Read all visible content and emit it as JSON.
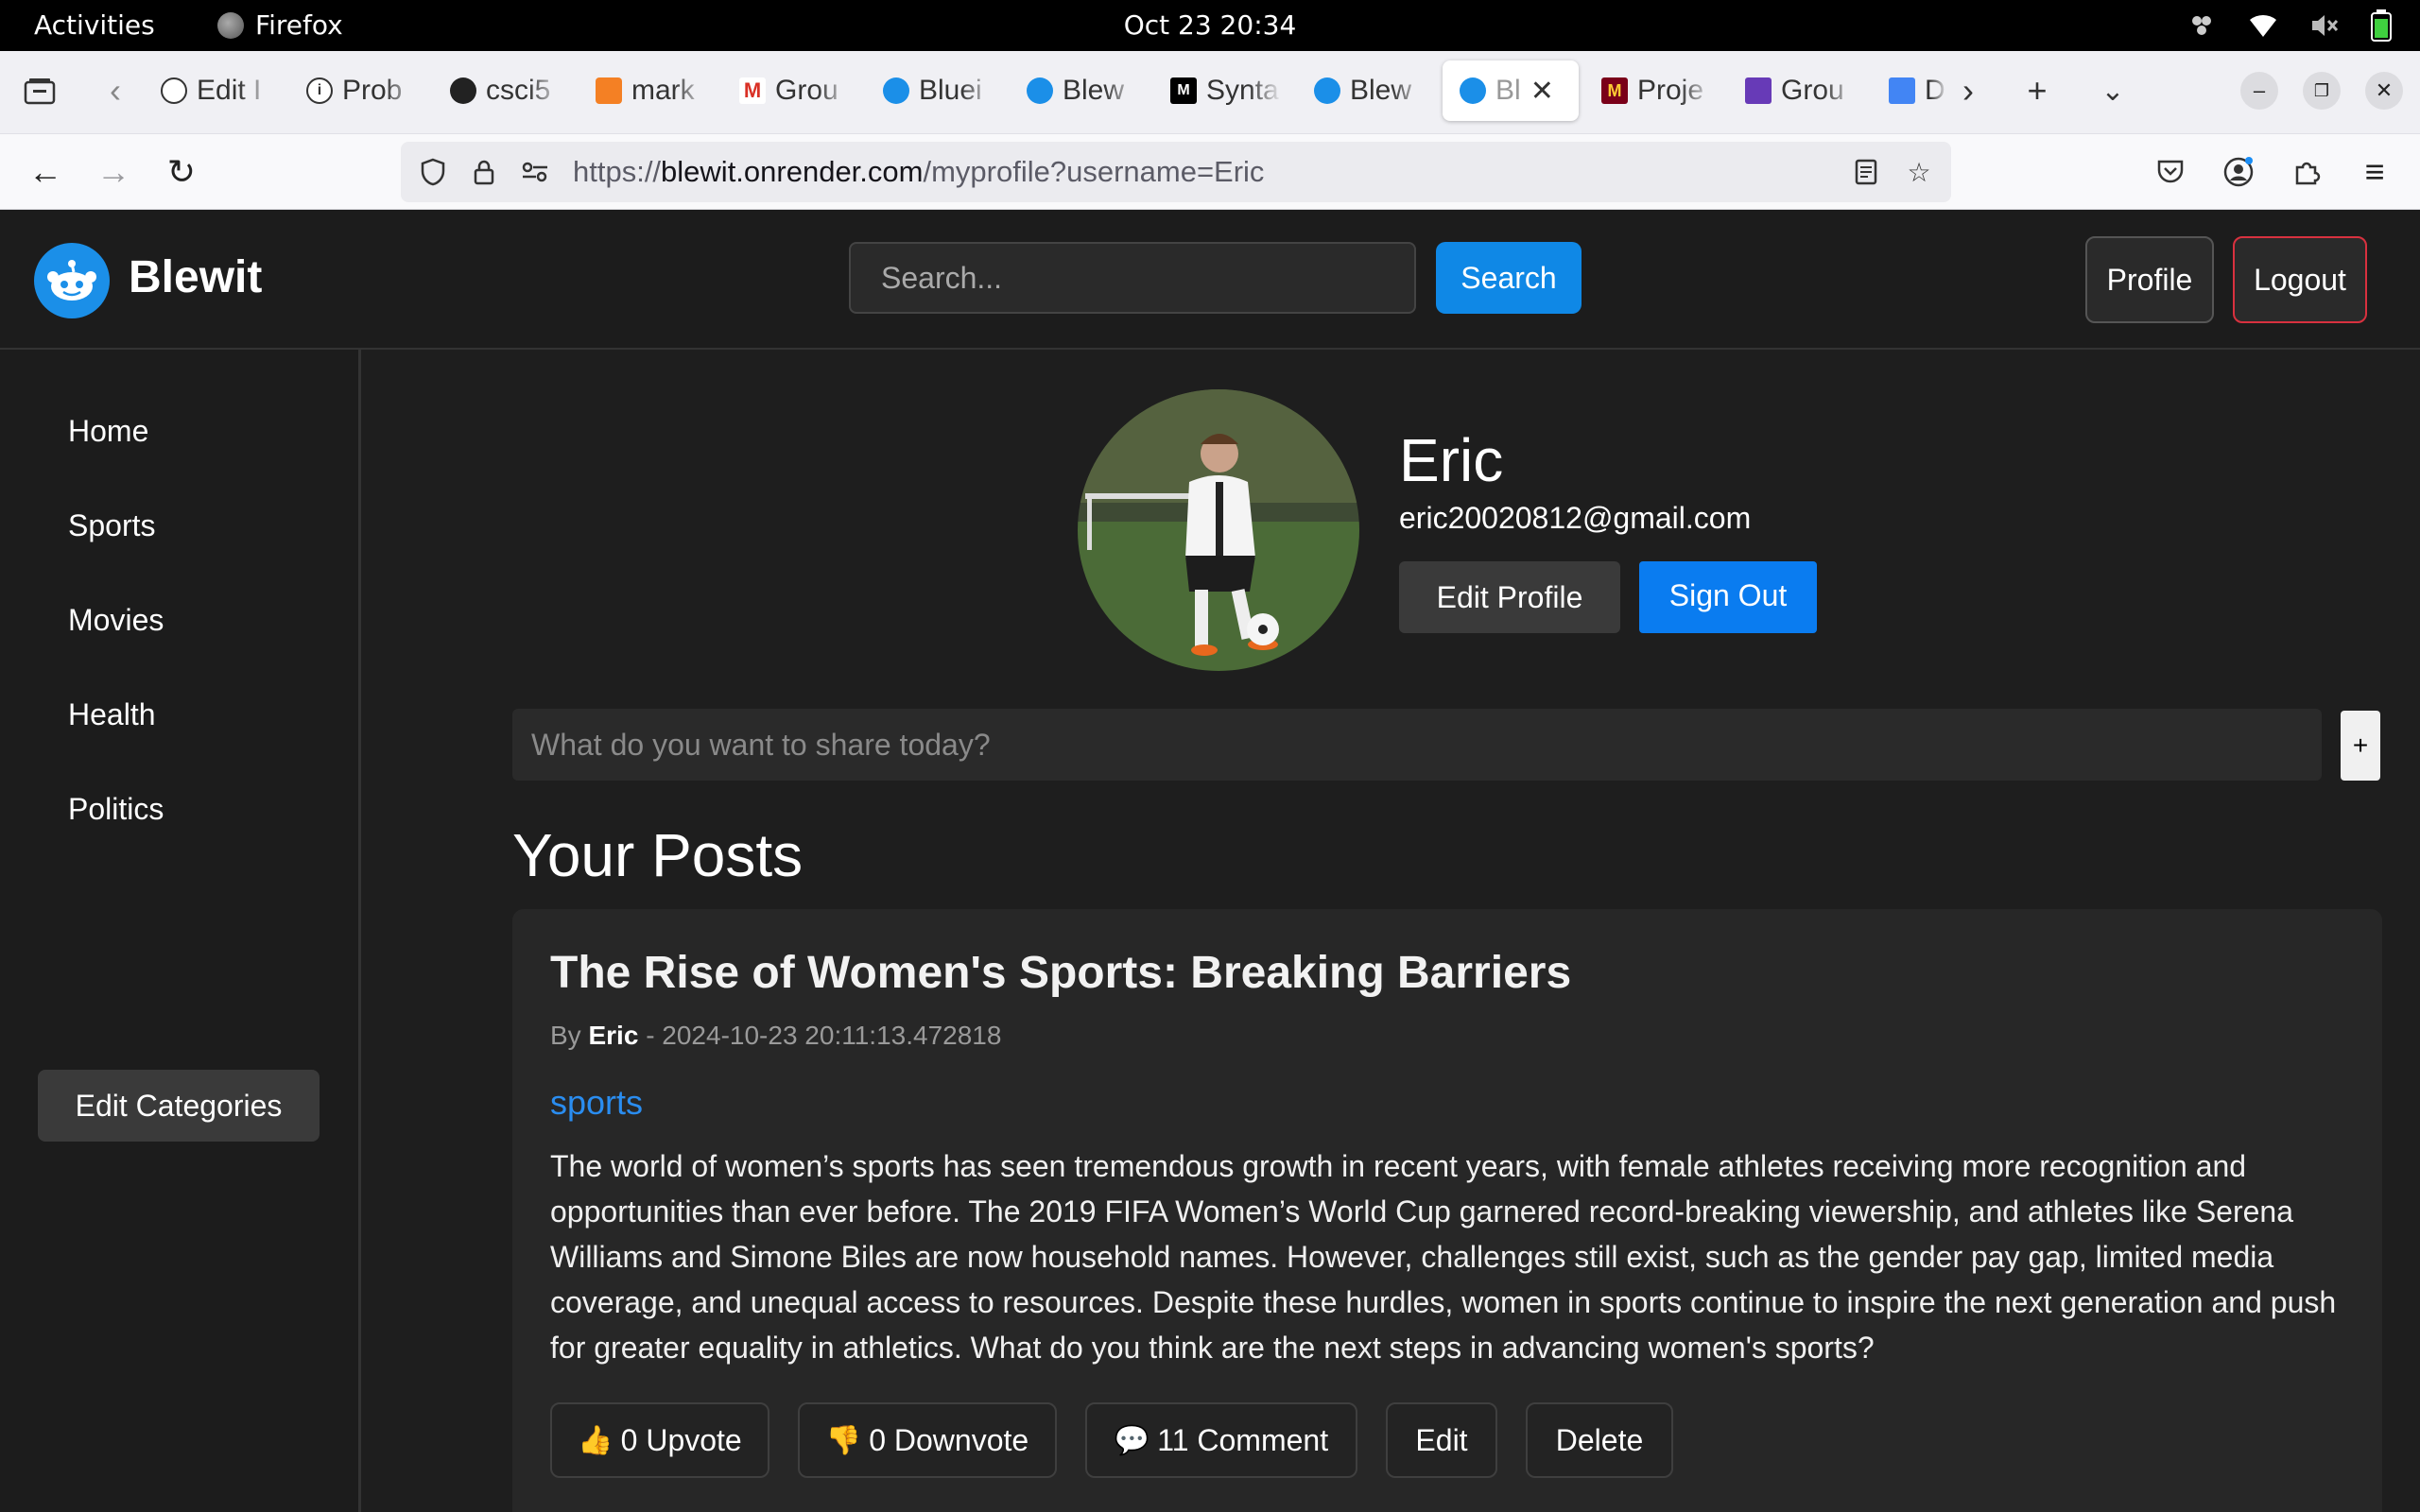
{
  "system_bar": {
    "activities": "Activities",
    "app_name": "Firefox",
    "clock": "Oct 23  20:34"
  },
  "browser": {
    "tabs": [
      {
        "label": "Edit I",
        "icon": "openai-icon"
      },
      {
        "label": "Prob",
        "icon": "info-icon"
      },
      {
        "label": "csci5",
        "icon": "github-icon"
      },
      {
        "label": "mark",
        "icon": "stackoverflow-icon"
      },
      {
        "label": "Grou",
        "icon": "gmail-icon"
      },
      {
        "label": "Bluei",
        "icon": "blewit-icon"
      },
      {
        "label": "Blew",
        "icon": "blewit-icon"
      },
      {
        "label": "Synta",
        "icon": "m-icon"
      },
      {
        "label": "Blew",
        "icon": "blewit-icon"
      },
      {
        "label": "Bl",
        "icon": "blewit-icon"
      },
      {
        "label": "Proje",
        "icon": "umn-icon"
      },
      {
        "label": "Grou",
        "icon": "forms-icon"
      },
      {
        "label": "D",
        "icon": "docs-icon"
      }
    ],
    "url_scheme": "https://",
    "url_domain": "blewit.onrender.com",
    "url_path": "/myprofile?username=Eric"
  },
  "site": {
    "brand": "Blewit",
    "search_placeholder": "Search...",
    "search_button": "Search",
    "profile_button": "Profile",
    "logout_button": "Logout"
  },
  "sidebar": {
    "items": [
      {
        "label": "Home"
      },
      {
        "label": "Sports"
      },
      {
        "label": "Movies"
      },
      {
        "label": "Health"
      },
      {
        "label": "Politics"
      }
    ],
    "edit_categories": "Edit Categories"
  },
  "profile": {
    "username": "Eric",
    "email": "eric20020812@gmail.com",
    "edit_profile": "Edit Profile",
    "sign_out": "Sign Out"
  },
  "share": {
    "placeholder": "What do you want to share today?",
    "add_label": "+"
  },
  "posts": {
    "heading": "Your Posts",
    "items": [
      {
        "title": "The Rise of Women's Sports: Breaking Barriers",
        "by_prefix": "By",
        "author": "Eric",
        "date": "- 2024-10-23 20:11:13.472818",
        "category": "sports",
        "body": "The world of women’s sports has seen tremendous growth in recent years, with female athletes receiving more recognition and opportunities than ever before. The 2019 FIFA Women’s World Cup garnered record-breaking viewership, and athletes like Serena Williams and Simone Biles are now household names. However, challenges still exist, such as the gender pay gap, limited media coverage, and unequal access to resources. Despite these hurdles, women in sports continue to inspire the next generation and push for greater equality in athletics. What do you think are the next steps in advancing women's sports?",
        "upvote_label": "0 Upvote",
        "downvote_label": "0 Downvote",
        "comment_label": "11 Comment",
        "edit_label": "Edit",
        "delete_label": "Delete"
      }
    ]
  }
}
